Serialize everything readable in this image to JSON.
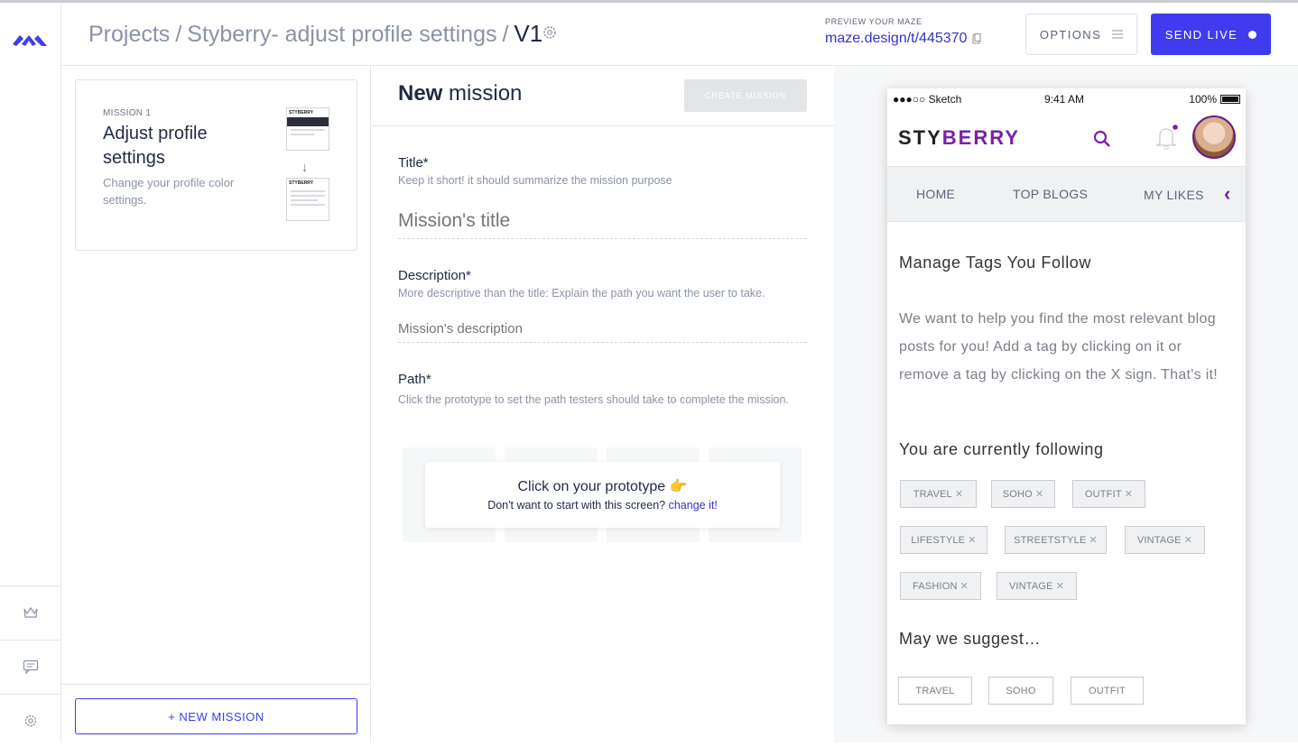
{
  "rail": {
    "logo_icon": "maze-logo-icon",
    "items": [
      {
        "name": "crown-icon"
      },
      {
        "name": "comment-icon"
      },
      {
        "name": "gear-icon"
      }
    ]
  },
  "header": {
    "breadcrumb_projects": "Projects",
    "breadcrumb_project": "Styberry- adjust profile settings",
    "breadcrumb_version": "V1",
    "sep": "/",
    "preview_label": "PREVIEW YOUR MAZE",
    "preview_link": "maze.design/t/445370",
    "options_label": "OPTIONS",
    "send_live_label": "SEND LIVE",
    "accent_color": "#3f3cf0"
  },
  "missions": {
    "card": {
      "number": "MISSION 1",
      "title": "Adjust profile settings",
      "description": "Change your profile color settings.",
      "thumb_brand": "STYBERRY"
    },
    "new_mission_label": "+ NEW MISSION"
  },
  "form": {
    "heading_bold": "New",
    "heading_rest": "mission",
    "create_label": "CREATE MISSION",
    "title_label": "Title*",
    "title_help": "Keep it short! it should summarize the mission purpose",
    "title_placeholder": "Mission's title",
    "description_label": "Description*",
    "description_help": "More descriptive than the title: Explain the path you want the user to take.",
    "description_placeholder": "Mission's description",
    "path_label": "Path*",
    "path_help": "Click the prototype to set the path testers should take to complete the mission.",
    "path_card_title": "Click on your prototype 👉",
    "path_card_sub": "Don't want to start with this screen?",
    "path_card_link": "change it!"
  },
  "phone": {
    "status_left": "●●●○○ Sketch",
    "status_time": "9:41 AM",
    "status_battery": "100%",
    "brand_part1": "STY",
    "brand_part2": "BERRY",
    "nav": [
      "HOME",
      "TOP BLOGS",
      "MY LIKES"
    ],
    "manage_heading": "Manage Tags You Follow",
    "intro": "We want to help you find the most relevant blog posts for you! Add a tag by clicking on it or remove a tag by clicking on the X sign. That's it!",
    "following_heading": "You are currently following",
    "following_tags": [
      "TRAVEL",
      "SOHO",
      "OUTFIT",
      "LIFESTYLE",
      "STREETSTYLE",
      "VINTAGE",
      "FASHION",
      "VINTAGE"
    ],
    "suggest_heading": "May we suggest…",
    "suggest_tags": [
      "TRAVEL",
      "SOHO",
      "OUTFIT"
    ],
    "brand_color": "#7a1fa8"
  }
}
